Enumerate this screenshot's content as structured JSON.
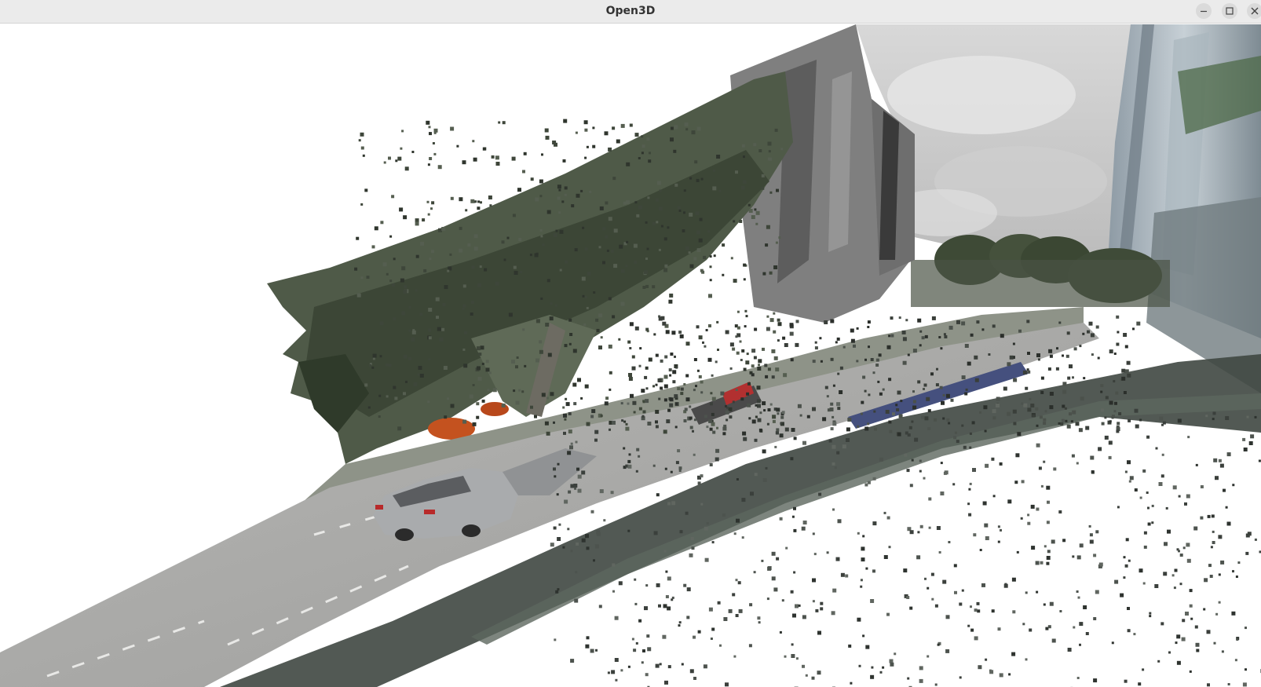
{
  "window": {
    "title": "Open3D",
    "controls": [
      "minimize",
      "maximize",
      "close"
    ],
    "icons": {
      "minimize": "minimize-icon",
      "maximize": "maximize-icon",
      "close": "close-icon"
    }
  },
  "viewport": {
    "background_color": "#ffffff",
    "content": "point-cloud"
  }
}
